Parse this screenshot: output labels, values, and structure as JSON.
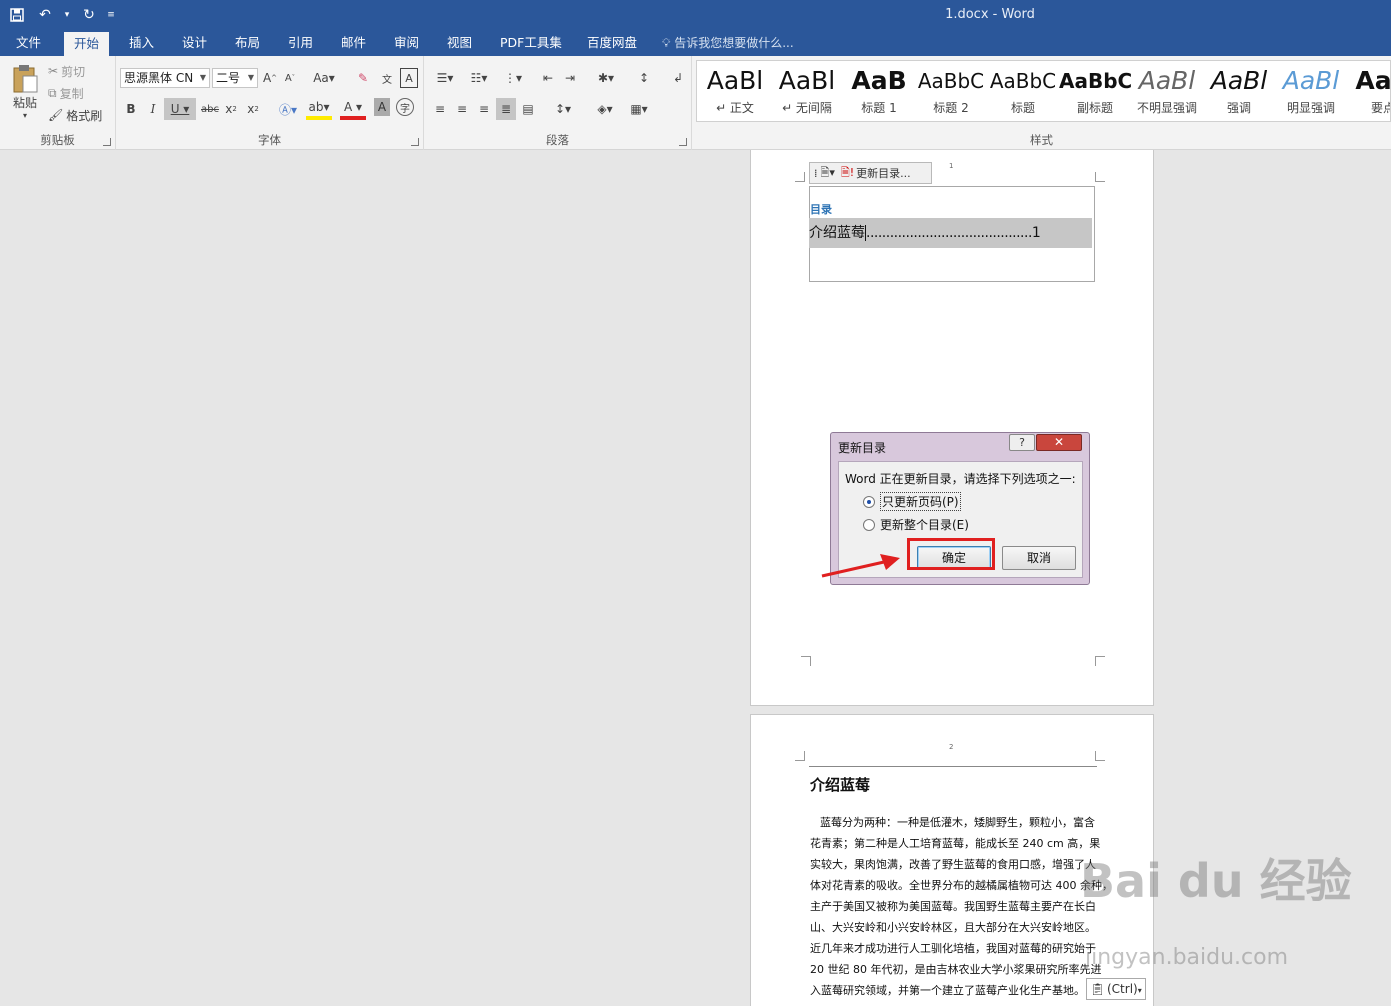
{
  "window": {
    "title": "1.docx - Word"
  },
  "tabs": [
    {
      "label": "文件"
    },
    {
      "label": "开始"
    },
    {
      "label": "插入"
    },
    {
      "label": "设计"
    },
    {
      "label": "布局"
    },
    {
      "label": "引用"
    },
    {
      "label": "邮件"
    },
    {
      "label": "审阅"
    },
    {
      "label": "视图"
    },
    {
      "label": "PDF工具集"
    },
    {
      "label": "百度网盘"
    }
  ],
  "tell_me": "告诉我您想要做什么...",
  "clipboard": {
    "paste": "粘贴",
    "cut": "剪切",
    "copy": "复制",
    "format_painter": "格式刷",
    "group": "剪贴板"
  },
  "font": {
    "name": "思源黑体 CN",
    "size": "二号",
    "group": "字体"
  },
  "paragraph": {
    "group": "段落"
  },
  "styles": {
    "group": "样式",
    "items": [
      {
        "sample": "AaBl",
        "name": "↵ 正文"
      },
      {
        "sample": "AaBl",
        "name": "↵ 无间隔"
      },
      {
        "sample": "AaB",
        "name": "标题 1"
      },
      {
        "sample": "AaBbC",
        "name": "标题 2"
      },
      {
        "sample": "AaBbC",
        "name": "标题"
      },
      {
        "sample": "AaBbC",
        "name": "副标题"
      },
      {
        "sample": "AaBl",
        "name": "不明显强调"
      },
      {
        "sample": "AaBl",
        "name": "强调"
      },
      {
        "sample": "AaBl",
        "name": "明显强调"
      },
      {
        "sample": "AaB",
        "name": "要点"
      }
    ]
  },
  "toc": {
    "control_button": "更新目录...",
    "heading": "目录",
    "entry_text": "介绍蓝莓",
    "entry_dots": "..........................................",
    "entry_page": "1",
    "page_number_1": "1"
  },
  "dialog": {
    "title": "更新目录",
    "help": "?",
    "close": "✕",
    "message": "Word 正在更新目录，请选择下列选项之一:",
    "option1": "只更新页码(P)",
    "option2": "更新整个目录(E)",
    "ok": "确定",
    "cancel": "取消"
  },
  "page2": {
    "page_number": "2",
    "title": "介绍蓝莓",
    "lines": [
      "蓝莓分为两种：一种是低灌木，矮脚野生，颗粒小，富含",
      "花青素；第二种是人工培育蓝莓，能成长至 240 cm 高，果",
      "实较大，果肉饱满，改善了野生蓝莓的食用口感，增强了人",
      "体对花青素的吸收。全世界分布的越橘属植物可达 400 余种，",
      "主产于美国又被称为美国蓝莓。我国野生蓝莓主要产在长白",
      "山、大兴安岭和小兴安岭林区，且大部分在大兴安岭地区。",
      "近几年来才成功进行人工驯化培植，我国对蓝莓的研究始于",
      "20 世纪 80 年代初，是由吉林农业大学小浆果研究所率先进",
      "入蓝莓研究领域，并第一个建立了蓝莓产业化生产基地。"
    ],
    "paste_ctrl": "(Ctrl)"
  },
  "watermark": {
    "main": "Bai du 经验",
    "sub": "jingyan.baidu.com"
  }
}
